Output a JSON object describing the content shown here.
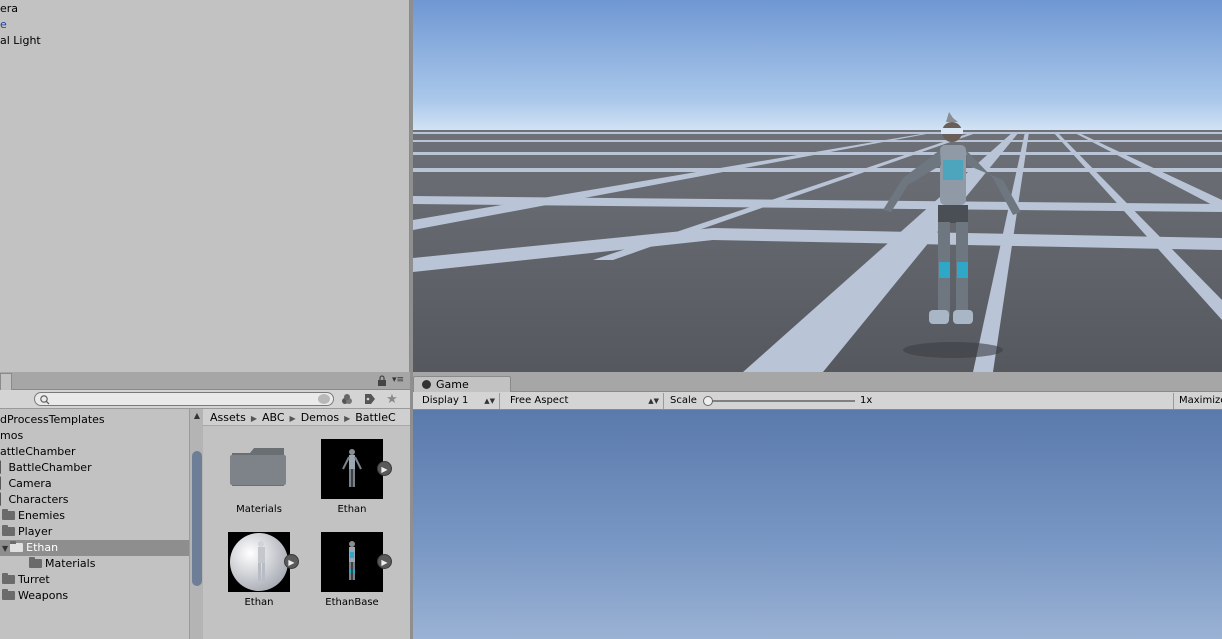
{
  "hierarchy": {
    "items": [
      "era",
      "e",
      "al Light"
    ]
  },
  "project": {
    "tree": [
      "dProcessTemplates",
      "mos",
      "attleChamber",
      "BattleChamber",
      "Camera",
      "Characters",
      "Enemies",
      "Player",
      "Ethan",
      "Materials",
      "Turret",
      "Weapons",
      "..."
    ],
    "breadcrumb": [
      "Assets",
      "ABC",
      "Demos",
      "BattleC"
    ],
    "assets": [
      {
        "label": "Materials"
      },
      {
        "label": "Ethan"
      },
      {
        "label": "Ethan"
      },
      {
        "label": "EthanBase"
      }
    ]
  },
  "game": {
    "tab_label": "Game",
    "display": "Display 1",
    "aspect": "Free Aspect",
    "scale_label": "Scale",
    "scale_value": "1x",
    "maximize_label": "Maximize"
  }
}
